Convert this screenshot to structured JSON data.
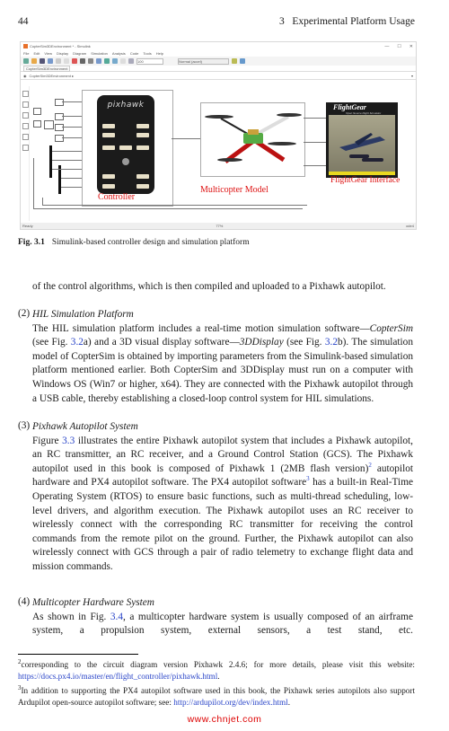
{
  "header": {
    "page_number": "44",
    "chapter": "3   Experimental Platform Usage"
  },
  "figure": {
    "window": {
      "title": "CopterSim3DEnvironment * - Simulink",
      "controls": [
        "—",
        "☐",
        "✕"
      ],
      "menu": [
        "File",
        "Edit",
        "View",
        "Display",
        "Diagram",
        "Simulation",
        "Analysis",
        "Code",
        "Tools",
        "Help"
      ],
      "toolbar_input": "100",
      "toolbar_select": "Normal (accel)",
      "breadcrumb_tab": "CopterSim3DEnvironment",
      "address": "CopterSim3DEnvironment ▸",
      "status_left": "Ready",
      "status_mid": "77%",
      "status_right": "ode4"
    },
    "pixhawk_logo": "pixhawk",
    "labels": {
      "controller": "Controller",
      "multicopter": "Multicopter Model",
      "flightgear": "FlightGear Interface"
    },
    "flightgear": {
      "title": "FlightGear",
      "subtitle": "Open Source Flight Simulator"
    },
    "caption_num": "Fig. 3.1",
    "caption_text": "Simulink-based controller design and simulation platform"
  },
  "body": {
    "p0": "of the control algorithms, which is then compiled and uploaded to a Pixhawk autopilot.",
    "items": [
      {
        "num": "(2)",
        "heading": "HIL Simulation Platform",
        "t1": "The HIL simulation platform includes a real-time motion simulation software—",
        "t2": "CopterSim",
        "t3": " (see Fig. ",
        "ref1": "3.2",
        "t4": "a) and a 3D visual display software—",
        "t5": "3DDisplay",
        "t6": " (see Fig. ",
        "ref2": "3.2",
        "t7": "b). The simulation model of CopterSim is obtained by importing parameters from the Simulink-based simulation platform mentioned earlier. Both CopterSim and 3DDisplay must run on a computer with Windows OS (Win7 or higher, x64). They are connected with the Pixhawk autopilot through a USB cable, thereby establishing a closed-loop control system for HIL simulations."
      },
      {
        "num": "(3)",
        "heading": "Pixhawk Autopilot System",
        "t1": "Figure ",
        "ref1": "3.3",
        "t2": " illustrates the entire Pixhawk autopilot system that includes a Pixhawk autopilot, an RC transmitter, an RC receiver, and a Ground Control Station (GCS). The Pixhawk autopilot used in this book is composed of Pixhawk 1 (2MB flash version)",
        "sup1": "2",
        "t3": " autopilot hardware and PX4 autopilot software. The PX4 autopilot software",
        "sup2": "3",
        "t4": " has a built-in Real-Time Operating System (RTOS) to ensure basic functions, such as multi-thread scheduling, low-level drivers, and algorithm execution. The Pixhawk autopilot uses an RC receiver to wirelessly connect with the corresponding RC transmitter for receiving the control commands from the remote pilot on the ground. Further, the Pixhawk autopilot can also wirelessly connect with GCS through a pair of radio telemetry to exchange flight data and mission commands."
      },
      {
        "num": "(4)",
        "heading": "Multicopter Hardware System",
        "t1": "As shown in Fig. ",
        "ref1": "3.4",
        "t2": ", a multicopter hardware system is usually composed of an airframe system, a propulsion system, external sensors, a test stand, etc."
      }
    ]
  },
  "footnotes": [
    {
      "mark": "2",
      "text": "corresponding to the circuit diagram version Pixhawk 2.4.6; for more details, please visit this website: ",
      "link": "https://docs.px4.io/master/en/flight_controller/pixhawk.html",
      "after": "."
    },
    {
      "mark": "3",
      "text": "In addition to supporting the PX4 autopilot software used in this book, the Pixhawk series autopilots also support Ardupilot open-source autopilot software; see: ",
      "link": "http://ardupilot.org/dev/index.html",
      "after": "."
    }
  ],
  "watermark": "www.chnjet.com"
}
